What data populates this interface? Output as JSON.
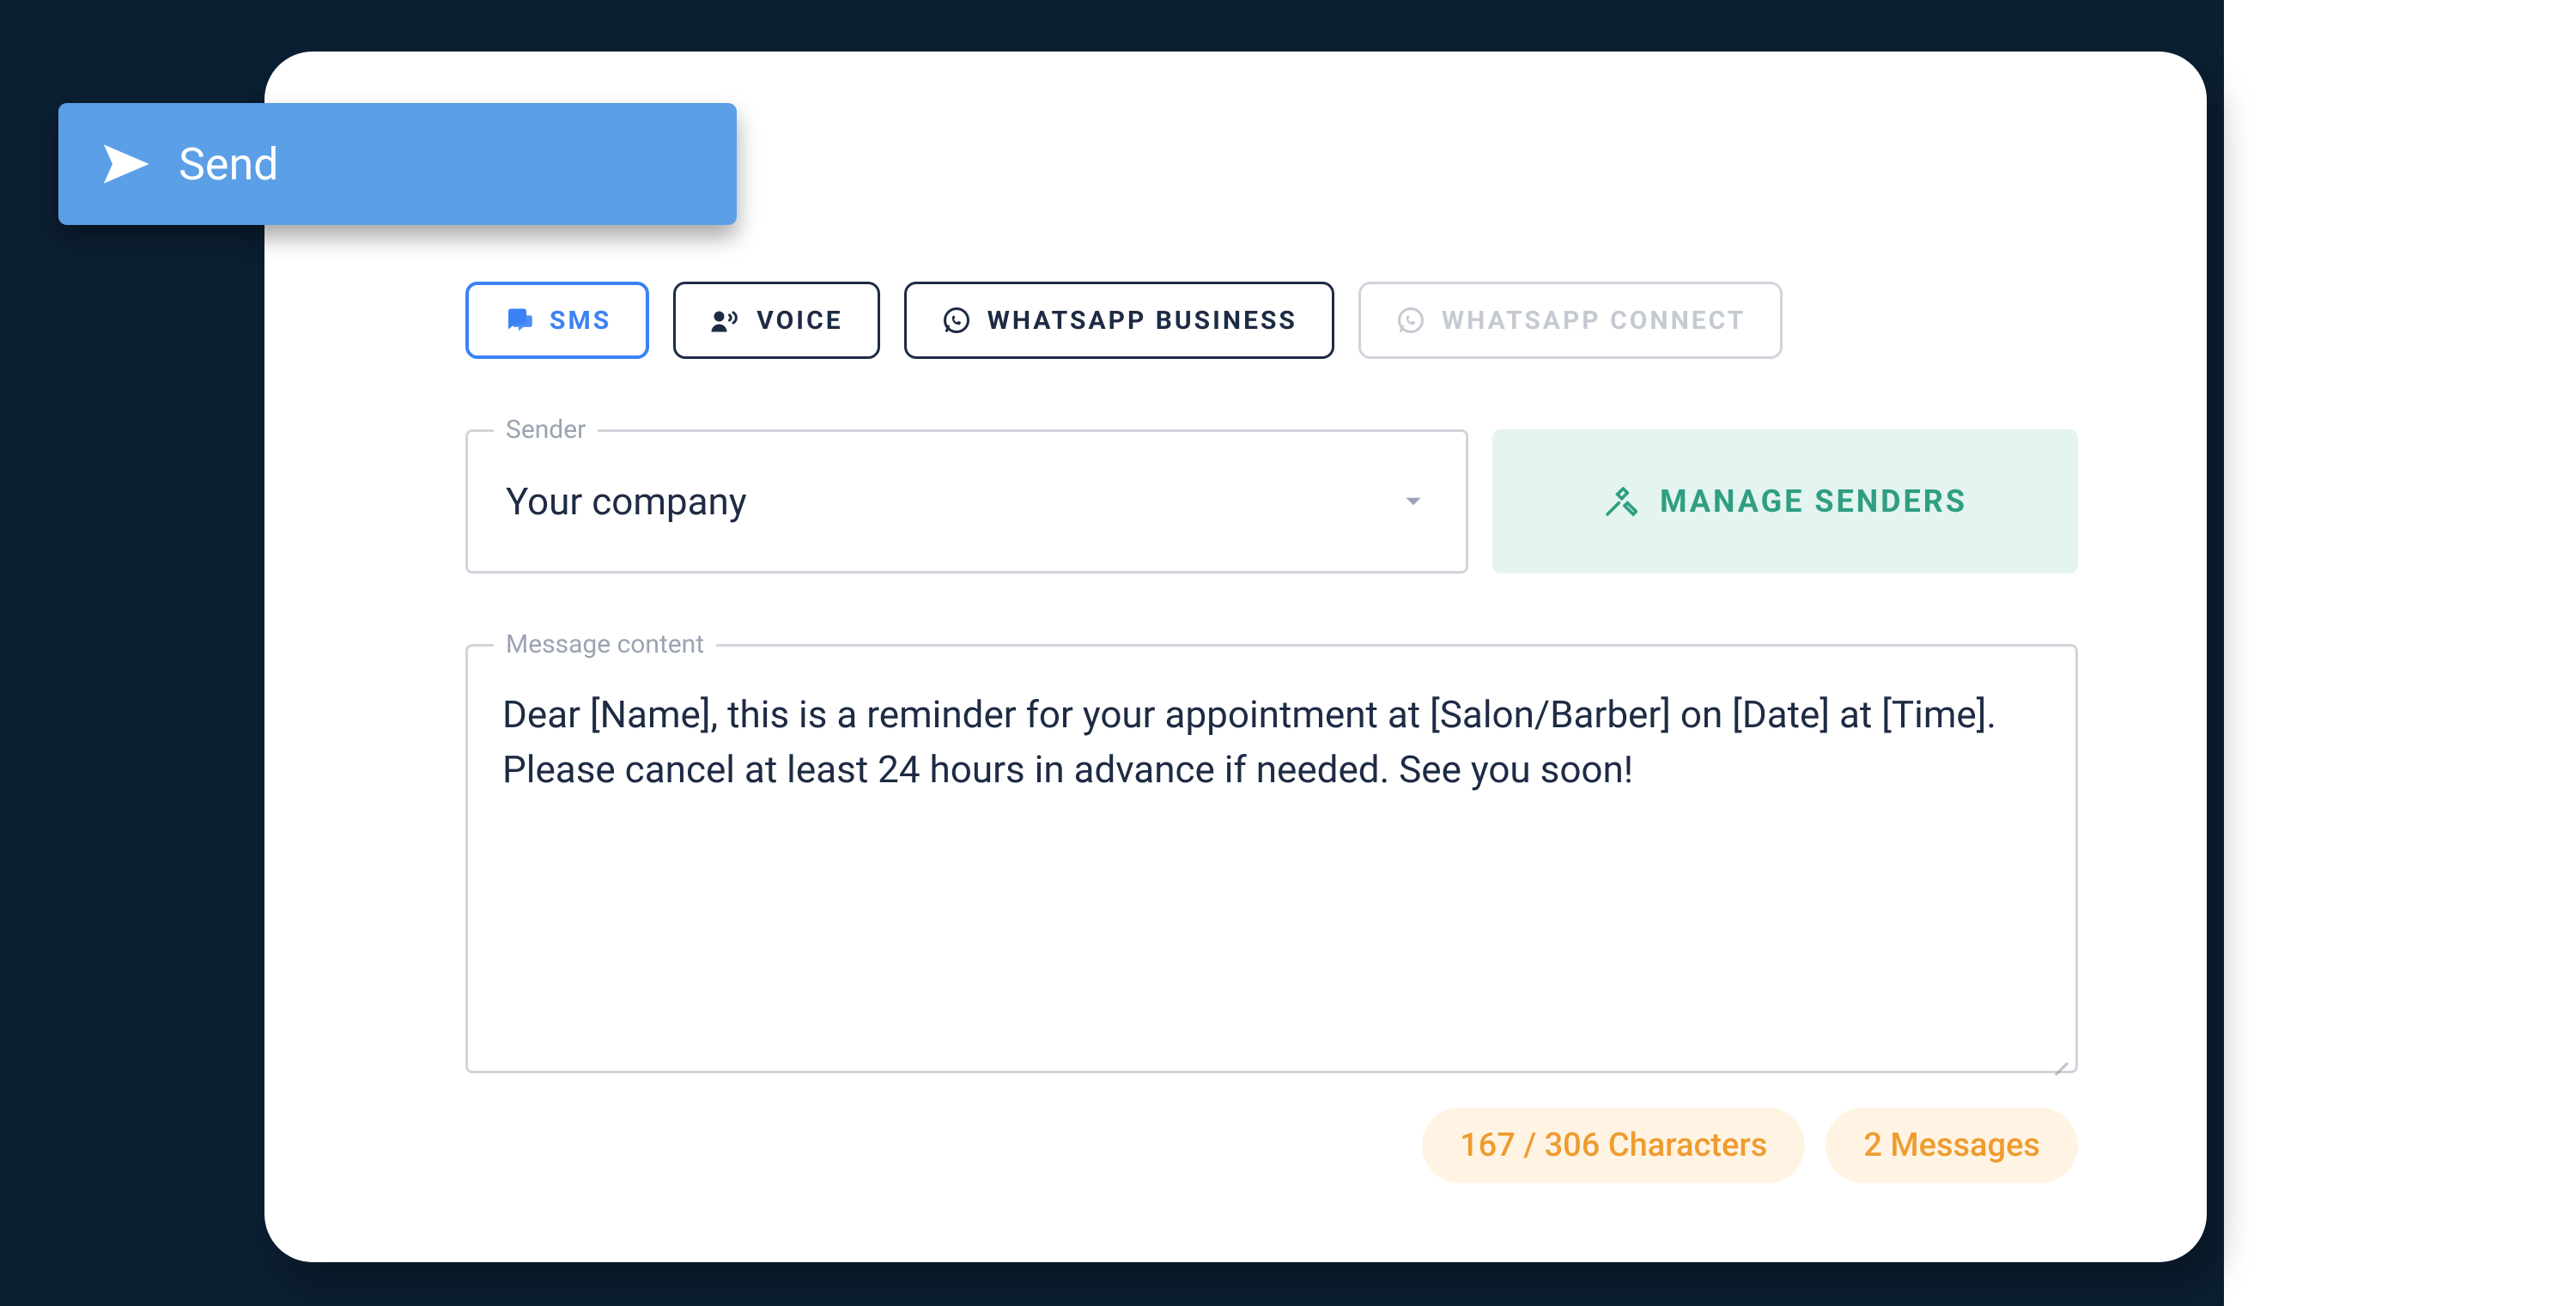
{
  "send_button": {
    "label": "Send"
  },
  "tabs": {
    "sms": "SMS",
    "voice": "VOICE",
    "whatsapp_business": "WHATSAPP BUSINESS",
    "whatsapp_connect": "WHATSAPP CONNECT"
  },
  "sender": {
    "legend": "Sender",
    "value": "Your company",
    "manage_label": "MANAGE SENDERS"
  },
  "message": {
    "legend": "Message content",
    "value": "Dear [Name], this is a reminder for your appointment at [Salon/Barber] on [Date] at [Time]. Please cancel at least 24 hours in advance if needed. See you soon!"
  },
  "stats": {
    "characters": "167 / 306 Characters",
    "messages": "2 Messages"
  }
}
